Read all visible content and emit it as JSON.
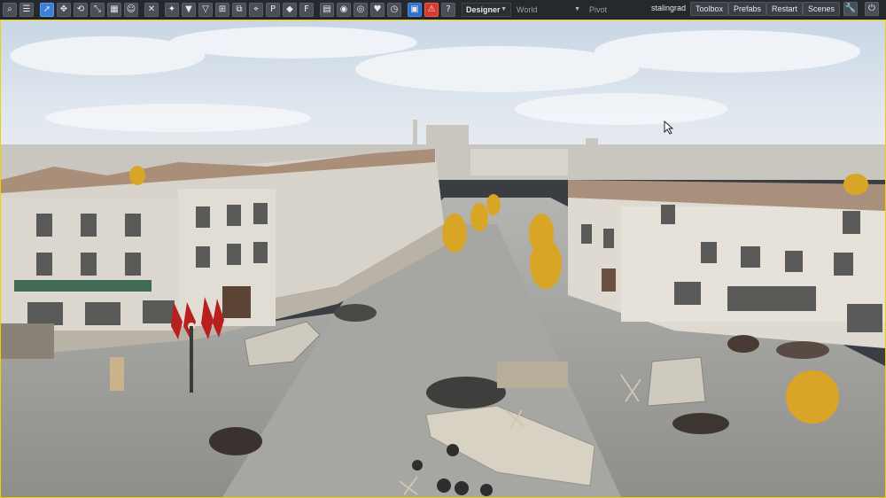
{
  "toolbar": {
    "tools": [
      {
        "icon": "magnifier-icon",
        "glyph": "⌕"
      },
      {
        "icon": "menu-icon",
        "glyph": "☰"
      },
      {
        "icon": "select-arrow-icon",
        "glyph": "➚"
      },
      {
        "icon": "move-icon",
        "glyph": "✥"
      },
      {
        "icon": "rotate-icon",
        "glyph": "⟲"
      },
      {
        "icon": "scale-icon",
        "glyph": "⤡"
      },
      {
        "icon": "grid-icon",
        "glyph": "▦"
      },
      {
        "icon": "face-icon",
        "glyph": "☺"
      },
      {
        "icon": "close-tool-icon",
        "glyph": "✕"
      },
      {
        "icon": "snap-icon",
        "glyph": "✦"
      },
      {
        "icon": "drop-down-icon",
        "glyph": "▼"
      },
      {
        "icon": "triangle-icon",
        "glyph": "▽"
      },
      {
        "icon": "bounds-icon",
        "glyph": "⊞"
      },
      {
        "icon": "split-icon",
        "glyph": "⧉"
      },
      {
        "icon": "target-icon",
        "glyph": "⌖"
      },
      {
        "icon": "parking-icon",
        "glyph": "P"
      },
      {
        "icon": "diamond-icon",
        "glyph": "◆"
      },
      {
        "icon": "flag-icon",
        "glyph": "F"
      },
      {
        "icon": "page-icon",
        "glyph": "▤"
      },
      {
        "icon": "eye-icon",
        "glyph": "◉"
      },
      {
        "icon": "eye-off-icon",
        "glyph": "◎"
      },
      {
        "icon": "heart-icon",
        "glyph": "♥"
      },
      {
        "icon": "timer-icon",
        "glyph": "◷"
      },
      {
        "icon": "save-icon",
        "glyph": "▣"
      },
      {
        "icon": "warning-icon",
        "glyph": "⚠"
      },
      {
        "icon": "help-icon",
        "glyph": "?"
      }
    ],
    "mode": "Designer",
    "space": "World",
    "pivot": "Pivot",
    "scene_name": "stalingrad",
    "buttons": {
      "toolbox": "Toolbox",
      "prefabs": "Prefabs",
      "restart": "Restart",
      "scenes": "Scenes"
    },
    "accent": "#3d7fd6",
    "warning_color": "#d63a2a"
  },
  "viewport": {
    "selection_border_color": "#f0d000"
  }
}
